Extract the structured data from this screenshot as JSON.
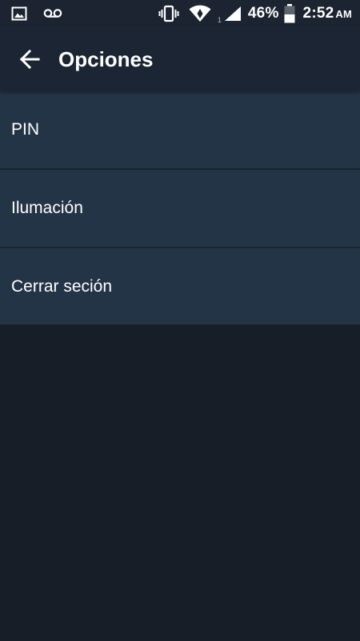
{
  "status_bar": {
    "left_icons": [
      "gallery-icon",
      "voicemail-icon"
    ],
    "right_icons": [
      "vibrate-icon",
      "wifi-icon",
      "signal-icon",
      "battery-icon"
    ],
    "signal_sim": "1",
    "battery_percent": "46%",
    "time": "2:52",
    "ampm": "AM"
  },
  "app_bar": {
    "back_icon": "arrow-left-icon",
    "title": "Opciones"
  },
  "options": [
    {
      "label": "PIN"
    },
    {
      "label": "Ilumación"
    },
    {
      "label": "Cerrar seción"
    }
  ],
  "colors": {
    "background": "#171e27",
    "status_bar": "#1b2430",
    "app_bar": "#1b2533",
    "list_item": "#243447",
    "divider": "#1a2430",
    "text": "#ffffff"
  }
}
